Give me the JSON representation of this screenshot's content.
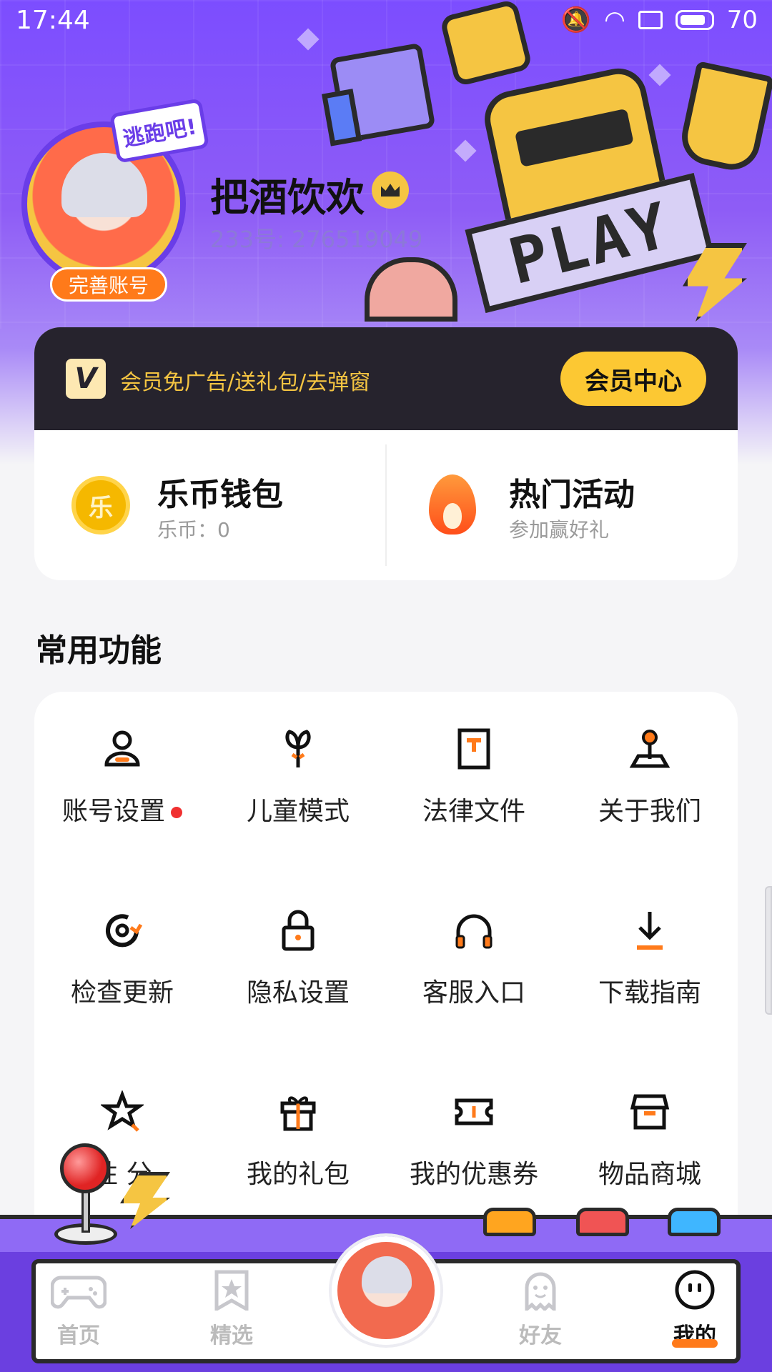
{
  "status_bar": {
    "time": "17:44",
    "battery": "70"
  },
  "profile": {
    "nickname": "把酒饮欢",
    "user_id": "233号: 276519049",
    "complete_account_label": "完善账号",
    "avatar_sticker": "逃跑吧!"
  },
  "banner": {
    "play_sign": "PLAY"
  },
  "vip": {
    "logo_letter": "V",
    "promo_text": "会员免广告/送礼包/去弹窗",
    "center_button": "会员中心"
  },
  "wallet": {
    "coin_icon_text": "乐",
    "title": "乐币钱包",
    "balance_text": "乐币：0"
  },
  "activities": {
    "title": "热门活动",
    "subtitle": "参加赢好礼"
  },
  "common_functions": {
    "title": "常用功能",
    "items": [
      {
        "label": "账号设置",
        "icon": "user-icon",
        "has_badge": true
      },
      {
        "label": "儿童模式",
        "icon": "sprout-icon"
      },
      {
        "label": "法律文件",
        "icon": "document-icon"
      },
      {
        "label": "关于我们",
        "icon": "joystick-icon"
      },
      {
        "label": "检查更新",
        "icon": "refresh-icon"
      },
      {
        "label": "隐私设置",
        "icon": "lock-icon"
      },
      {
        "label": "客服入口",
        "icon": "headphones-icon"
      },
      {
        "label": "下载指南",
        "icon": "download-icon"
      },
      {
        "label": "性    分",
        "icon": "star-icon"
      },
      {
        "label": "我的礼包",
        "icon": "gift-icon"
      },
      {
        "label": "我的优惠券",
        "icon": "ticket-icon"
      },
      {
        "label": "物品商城",
        "icon": "shop-icon"
      }
    ]
  },
  "bottom_nav": {
    "tabs": [
      {
        "label": "首页",
        "icon": "gamepad-icon"
      },
      {
        "label": "精选",
        "icon": "star-bookmark-icon"
      },
      {
        "label": "好友",
        "icon": "ghost-icon"
      },
      {
        "label": "我的",
        "icon": "smiley-icon",
        "active": true
      }
    ]
  },
  "colors": {
    "brand_purple": "#7c4dff",
    "vip_gold": "#fcc833",
    "accent_orange": "#ff7a1a",
    "dark": "#26232d"
  }
}
